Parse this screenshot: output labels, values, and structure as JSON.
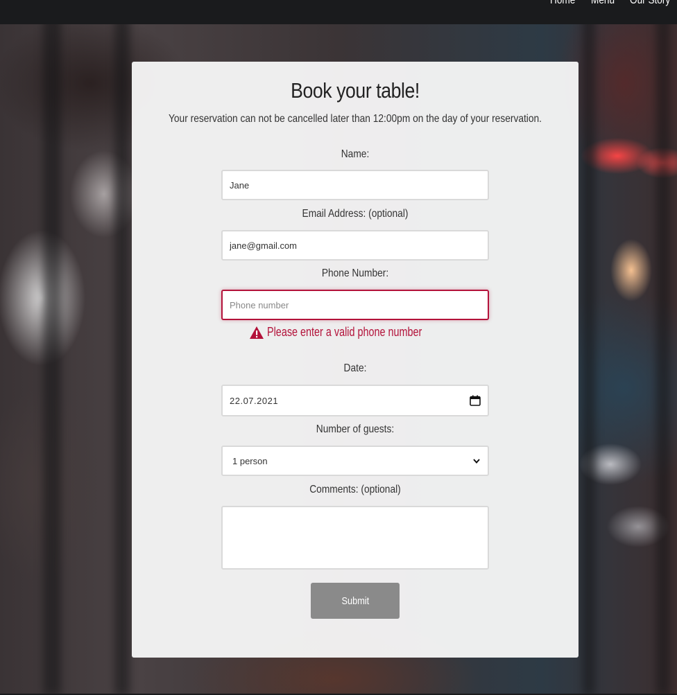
{
  "nav": {
    "items": [
      "Home",
      "Menu",
      "Our Story"
    ]
  },
  "form": {
    "title": "Book your table!",
    "notice": "Your reservation can not be cancelled later than 12:00pm on the day of your reservation.",
    "name": {
      "label": "Name:",
      "value": "Jane"
    },
    "email": {
      "label": "Email Address: (optional)",
      "value": "jane@gmail.com"
    },
    "phone": {
      "label": "Phone Number:",
      "value": "",
      "placeholder": "Phone number",
      "error": "Please enter a valid phone number"
    },
    "date": {
      "label": "Date:",
      "value": "22.07.2021"
    },
    "guests": {
      "label": "Number of guests:",
      "selected": "1 person"
    },
    "comments": {
      "label": "Comments: (optional)",
      "value": ""
    },
    "submit_label": "Submit"
  },
  "icons": {
    "warning": "warning-icon",
    "calendar": "calendar-icon",
    "dropdown": "chevron-down-icon"
  },
  "colors": {
    "error": "#b3123a",
    "submit_bg": "#8a8a8a",
    "navbar_bg": "#1a1b1d"
  }
}
